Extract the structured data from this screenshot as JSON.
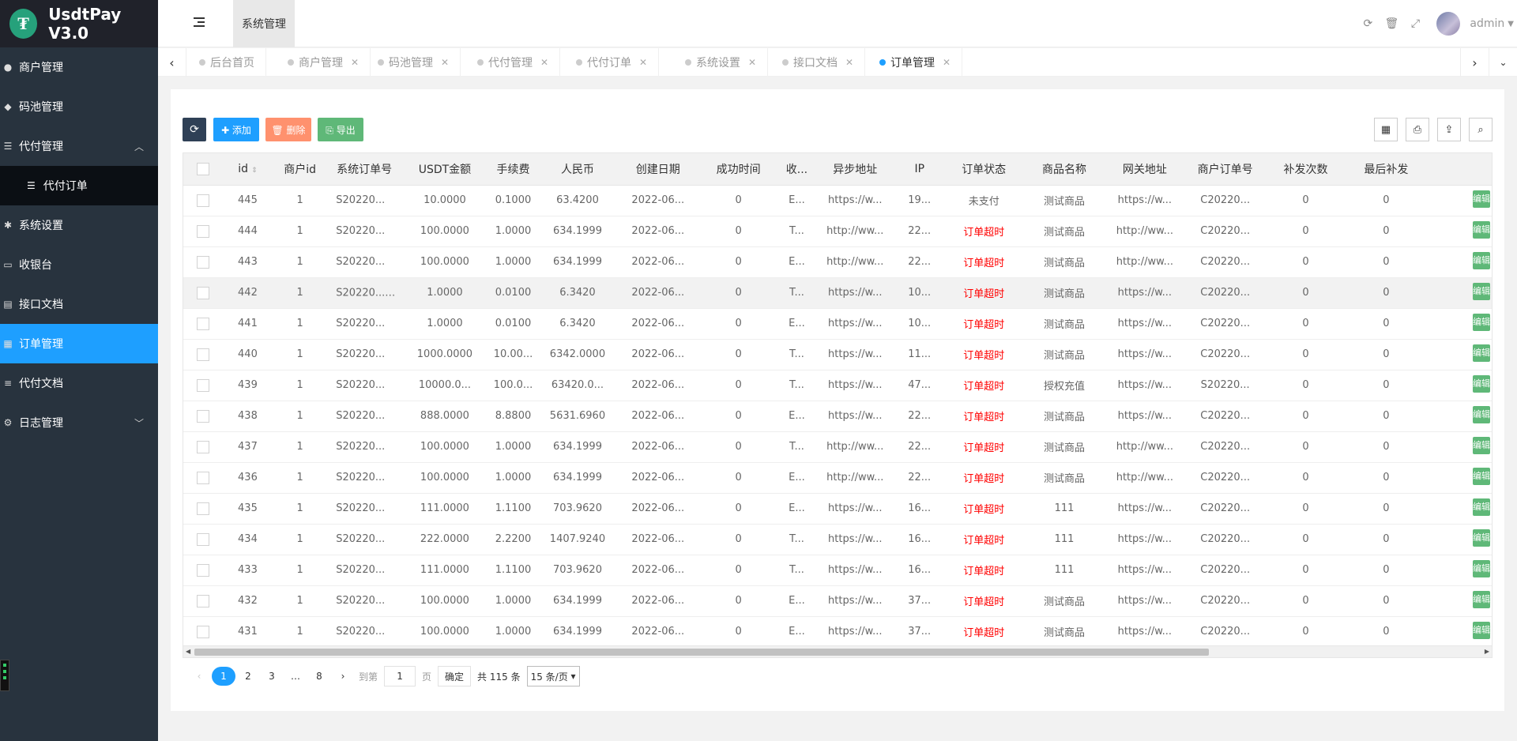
{
  "app": {
    "logo_glyph": "₮",
    "title": "UsdtPay V3.0"
  },
  "sidebar": {
    "items": [
      {
        "icon": "user-icon",
        "glyph": "●",
        "label": "商户管理"
      },
      {
        "icon": "android-icon",
        "glyph": "◆",
        "label": "码池管理"
      },
      {
        "icon": "list-icon",
        "glyph": "☰",
        "label": "代付管理",
        "expanded": true
      },
      {
        "icon": "list-icon",
        "glyph": "☰",
        "label": "代付订单",
        "sub": true
      },
      {
        "icon": "asterisk-icon",
        "glyph": "✱",
        "label": "系统设置"
      },
      {
        "icon": "cashier-icon",
        "glyph": "▭",
        "label": "收银台"
      },
      {
        "icon": "book-icon",
        "glyph": "▤",
        "label": "接口文档"
      },
      {
        "icon": "calculator-icon",
        "glyph": "▦",
        "label": "订单管理",
        "active": true
      },
      {
        "icon": "align-icon",
        "glyph": "≡",
        "label": "代付文档"
      },
      {
        "icon": "gear-icon",
        "glyph": "⚙",
        "label": "日志管理",
        "collapsible": true
      }
    ]
  },
  "header": {
    "current_section": "系统管理",
    "user": "admin"
  },
  "tabs": [
    {
      "label": "后台首页",
      "closable": false
    },
    {
      "label": "商户管理",
      "closable": true
    },
    {
      "label": "码池管理",
      "closable": true
    },
    {
      "label": "代付管理",
      "closable": true
    },
    {
      "label": "代付订单",
      "closable": true
    },
    {
      "label": "系统设置",
      "closable": true
    },
    {
      "label": "接口文档",
      "closable": true
    },
    {
      "label": "订单管理",
      "closable": true,
      "active": true
    }
  ],
  "toolbar": {
    "add": "✚ 添加",
    "delete": "🗑 删除",
    "export": "⎘ 导出"
  },
  "table": {
    "columns": [
      "id",
      "商户id",
      "系统订单号",
      "USDT金额",
      "手续费",
      "人民币",
      "创建日期",
      "成功时间",
      "收...",
      "异步地址",
      "IP",
      "订单状态",
      "商品名称",
      "网关地址",
      "商户订单号",
      "补发次数",
      "最后补发"
    ],
    "rows": [
      [
        "445",
        "1",
        "S20220...",
        "10.0000",
        "0.1000",
        "63.4200",
        "2022-06...",
        "0",
        "E...",
        "https://w...",
        "19...",
        "未支付",
        "测试商品",
        "https://w...",
        "C20220...",
        "0",
        "0"
      ],
      [
        "444",
        "1",
        "S20220...",
        "100.0000",
        "1.0000",
        "634.1999",
        "2022-06...",
        "0",
        "T...",
        "http://ww...",
        "22...",
        "订单超时",
        "测试商品",
        "http://ww...",
        "C20220...",
        "0",
        "0"
      ],
      [
        "443",
        "1",
        "S20220...",
        "100.0000",
        "1.0000",
        "634.1999",
        "2022-06...",
        "0",
        "E...",
        "http://ww...",
        "22...",
        "订单超时",
        "测试商品",
        "http://ww...",
        "C20220...",
        "0",
        "0"
      ],
      [
        "442",
        "1",
        "S20220...",
        "1.0000",
        "0.0100",
        "6.3420",
        "2022-06...",
        "0",
        "T...",
        "https://w...",
        "10...",
        "订单超时",
        "测试商品",
        "https://w...",
        "C20220...",
        "0",
        "0"
      ],
      [
        "441",
        "1",
        "S20220...",
        "1.0000",
        "0.0100",
        "6.3420",
        "2022-06...",
        "0",
        "E...",
        "https://w...",
        "10...",
        "订单超时",
        "测试商品",
        "https://w...",
        "C20220...",
        "0",
        "0"
      ],
      [
        "440",
        "1",
        "S20220...",
        "1000.0000",
        "10.00...",
        "6342.0000",
        "2022-06...",
        "0",
        "T...",
        "https://w...",
        "11...",
        "订单超时",
        "测试商品",
        "https://w...",
        "C20220...",
        "0",
        "0"
      ],
      [
        "439",
        "1",
        "S20220...",
        "10000.0...",
        "100.0...",
        "63420.0...",
        "2022-06...",
        "0",
        "T...",
        "https://w...",
        "47...",
        "订单超时",
        "授权充值",
        "https://w...",
        "S20220...",
        "0",
        "0"
      ],
      [
        "438",
        "1",
        "S20220...",
        "888.0000",
        "8.8800",
        "5631.6960",
        "2022-06...",
        "0",
        "E...",
        "https://w...",
        "22...",
        "订单超时",
        "测试商品",
        "https://w...",
        "C20220...",
        "0",
        "0"
      ],
      [
        "437",
        "1",
        "S20220...",
        "100.0000",
        "1.0000",
        "634.1999",
        "2022-06...",
        "0",
        "T...",
        "http://ww...",
        "22...",
        "订单超时",
        "测试商品",
        "http://ww...",
        "C20220...",
        "0",
        "0"
      ],
      [
        "436",
        "1",
        "S20220...",
        "100.0000",
        "1.0000",
        "634.1999",
        "2022-06...",
        "0",
        "E...",
        "http://ww...",
        "22...",
        "订单超时",
        "测试商品",
        "http://ww...",
        "C20220...",
        "0",
        "0"
      ],
      [
        "435",
        "1",
        "S20220...",
        "111.0000",
        "1.1100",
        "703.9620",
        "2022-06...",
        "0",
        "E...",
        "https://w...",
        "16...",
        "订单超时",
        "111",
        "https://w...",
        "C20220...",
        "0",
        "0"
      ],
      [
        "434",
        "1",
        "S20220...",
        "222.0000",
        "2.2200",
        "1407.9240",
        "2022-06...",
        "0",
        "T...",
        "https://w...",
        "16...",
        "订单超时",
        "111",
        "https://w...",
        "C20220...",
        "0",
        "0"
      ],
      [
        "433",
        "1",
        "S20220...",
        "111.0000",
        "1.1100",
        "703.9620",
        "2022-06...",
        "0",
        "T...",
        "https://w...",
        "16...",
        "订单超时",
        "111",
        "https://w...",
        "C20220...",
        "0",
        "0"
      ],
      [
        "432",
        "1",
        "S20220...",
        "100.0000",
        "1.0000",
        "634.1999",
        "2022-06...",
        "0",
        "E...",
        "https://w...",
        "37...",
        "订单超时",
        "测试商品",
        "https://w...",
        "C20220...",
        "0",
        "0"
      ],
      [
        "431",
        "1",
        "S20220...",
        "100.0000",
        "1.0000",
        "634.1999",
        "2022-06...",
        "0",
        "E...",
        "https://w...",
        "37...",
        "订单超时",
        "测试商品",
        "https://w...",
        "C20220...",
        "0",
        "0"
      ]
    ],
    "edit_label": "编辑",
    "highlight_row": 3,
    "red_status": "订单超时"
  },
  "pager": {
    "pages": [
      "1",
      "2",
      "3",
      "…",
      "8"
    ],
    "current": "1",
    "goto_label": "到第",
    "goto_value": "1",
    "page_unit": "页",
    "confirm": "确定",
    "total": "共 115 条",
    "per_page": "15 条/页"
  },
  "colors": {
    "accent": "#1e9fff",
    "sidebar": "#28333e",
    "danger": "#ff0000",
    "success": "#5fb878"
  }
}
